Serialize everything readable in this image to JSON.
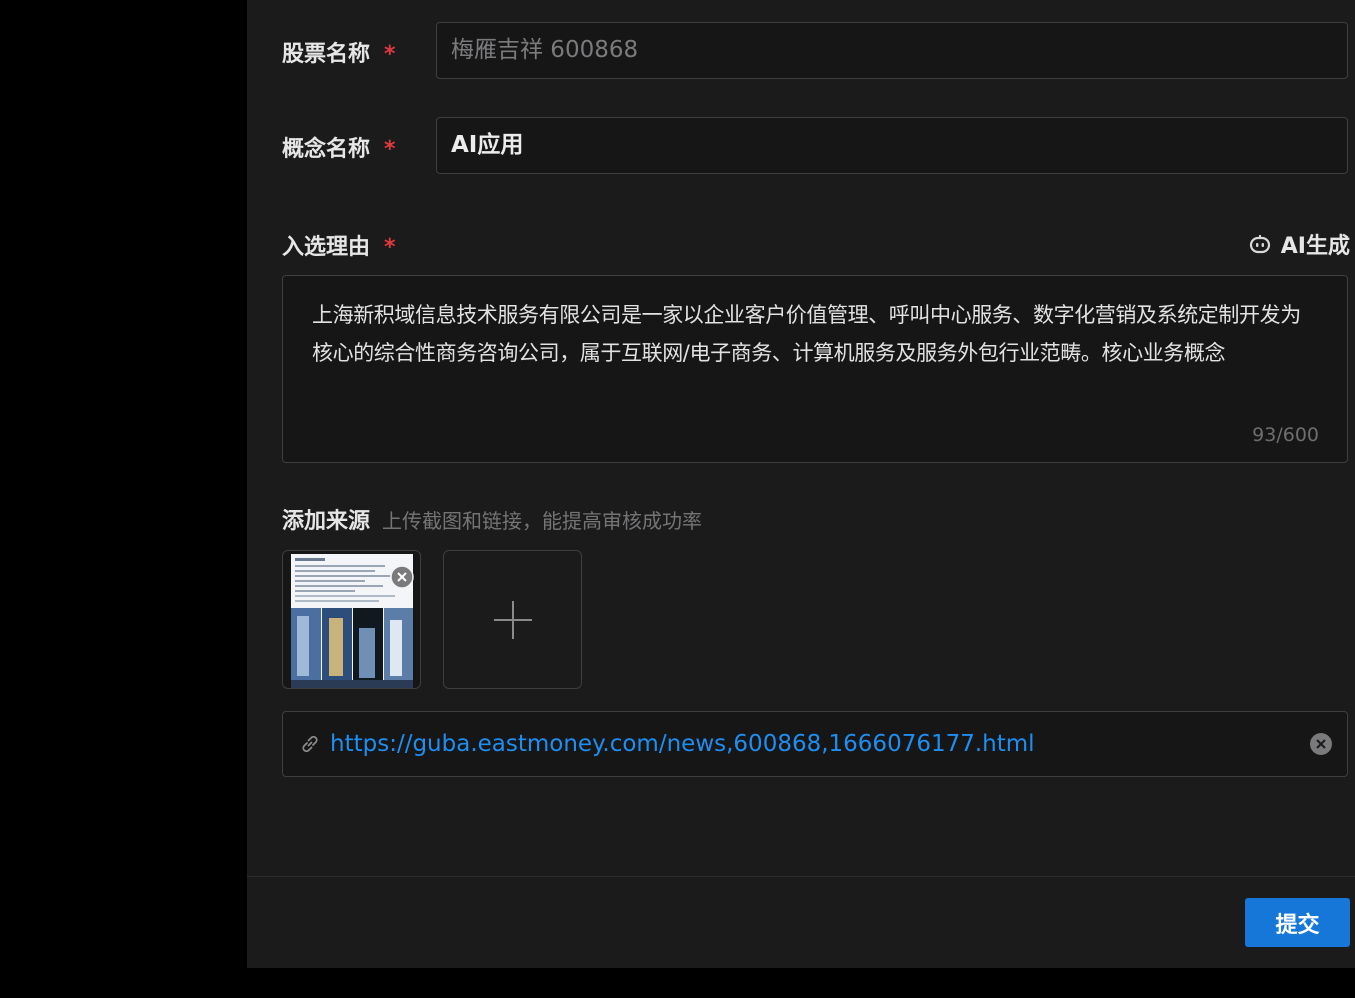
{
  "form": {
    "stock_name_label": "股票名称",
    "stock_name_value": "梅雁吉祥 600868",
    "concept_name_label": "概念名称",
    "concept_name_value": "AI应用",
    "reason_label": "入选理由",
    "required_mark": "*",
    "ai_generate_label": "AI生成",
    "reason_text": "上海新积域信息技术服务有限公司是一家以企业客户价值管理、呼叫中心服务、数字化营销及系统定制开发为核心的综合性商务咨询公司，属于互联网/电子商务、计算机服务及服务外包行业范畴。核心业务概念",
    "reason_counter": "93/600"
  },
  "source": {
    "title": "添加来源",
    "hint": "上传截图和链接，能提高审核成功率",
    "link_url": "https://guba.eastmoney.com/news,600868,1666076177.html"
  },
  "footer": {
    "submit_label": "提交"
  },
  "icons": {
    "ai": "robot-icon",
    "remove": "close-circle-icon",
    "add": "plus-icon",
    "link": "link-icon",
    "clear": "close-circle-icon"
  },
  "colors": {
    "accent": "#1677d9",
    "link": "#1f8ef1",
    "required": "#e0393e"
  }
}
